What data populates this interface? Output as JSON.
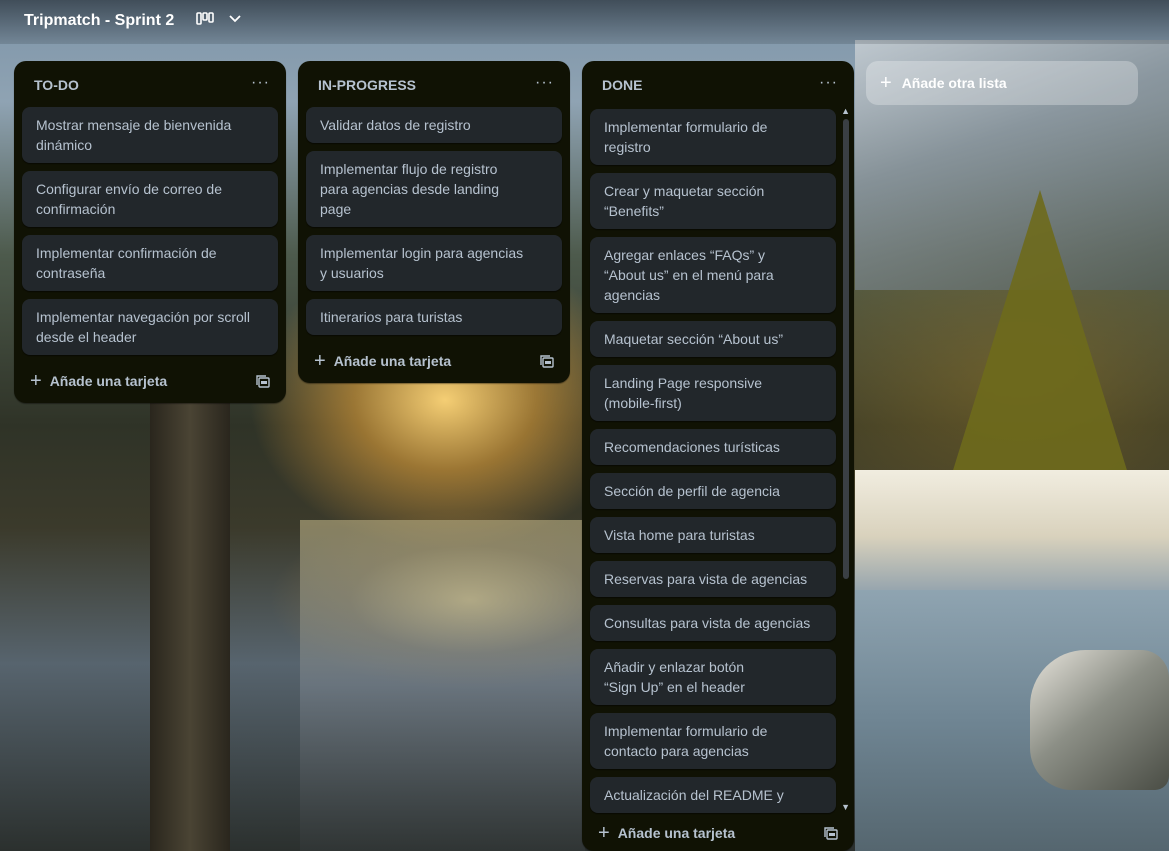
{
  "board": {
    "title": "Tripmatch - Sprint 2"
  },
  "icons": {
    "board_view": "board-view-icon",
    "chevron": "chevron-down-icon",
    "menu": "more-icon",
    "plus": "plus-icon",
    "template": "card-template-icon"
  },
  "lists": [
    {
      "title": "TO-DO",
      "menu_glyph": "···",
      "add_label": "Añade una tarjeta",
      "cards": [
        "Mostrar mensaje de bienvenida dinámico",
        "Configurar envío de correo de confirmación",
        "Implementar confirmación de contraseña",
        "Implementar navegación por scroll desde el header"
      ]
    },
    {
      "title": "IN-PROGRESS",
      "menu_glyph": "···",
      "add_label": "Añade una tarjeta",
      "cards": [
        "Validar datos de registro",
        "Implementar flujo de registro para agencias desde landing page",
        "Implementar login para agencias y usuarios",
        "Itinerarios para turistas"
      ]
    },
    {
      "title": "DONE",
      "menu_glyph": "···",
      "add_label": "Añade una tarjeta",
      "cards": [
        "Implementar formulario de registro",
        "Crear y maquetar sección “Benefits”",
        "Agregar enlaces “FAQs” y “About us” en el menú para agencias",
        "Maquetar sección “About us”",
        "Landing Page responsive (mobile-first)",
        "Recomendaciones turísticas",
        "Sección de perfil de agencia",
        "Vista home para turistas",
        "Reservas para vista de agencias",
        "Consultas para vista de agencias",
        "Añadir y enlazar botón “Sign Up” en el header",
        "Implementar formulario de contacto para agencias",
        "Actualización del README y"
      ]
    }
  ],
  "add_list_label": "Añade otra lista",
  "colors": {
    "list_bg": "#101204",
    "card_bg": "#22272b",
    "text": "#b6c2cf"
  }
}
